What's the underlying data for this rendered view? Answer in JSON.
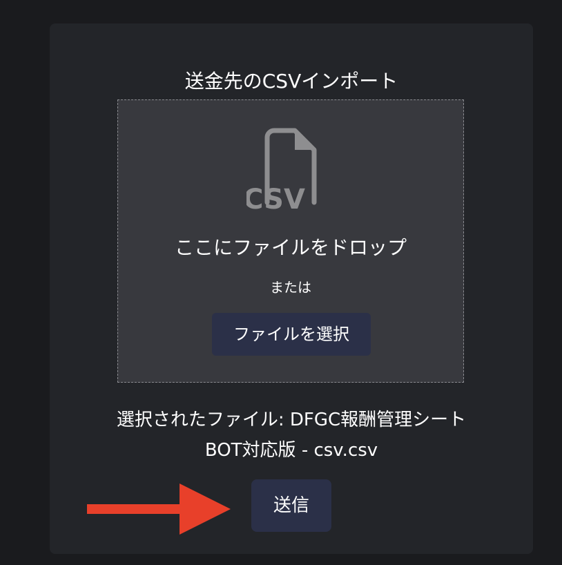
{
  "card": {
    "title": "送金先のCSVインポート",
    "dropzone": {
      "icon": "csv-file-icon",
      "drop_text": "ここにファイルをドロップ",
      "or_text": "または",
      "select_button": "ファイルを選択"
    },
    "selected_file": {
      "line1": "選択されたファイル: DFGC報酬管理シート",
      "line2": "BOT対応版 - csv.csv"
    },
    "submit_button": "送信"
  },
  "annotation": {
    "icon": "arrow-right-icon",
    "color": "#e8402a"
  },
  "colors": {
    "background": "#1a1b1e",
    "card": "#232529",
    "dropzone": "#38393e",
    "button": "#2b3048",
    "icon": "#8e8e90"
  }
}
